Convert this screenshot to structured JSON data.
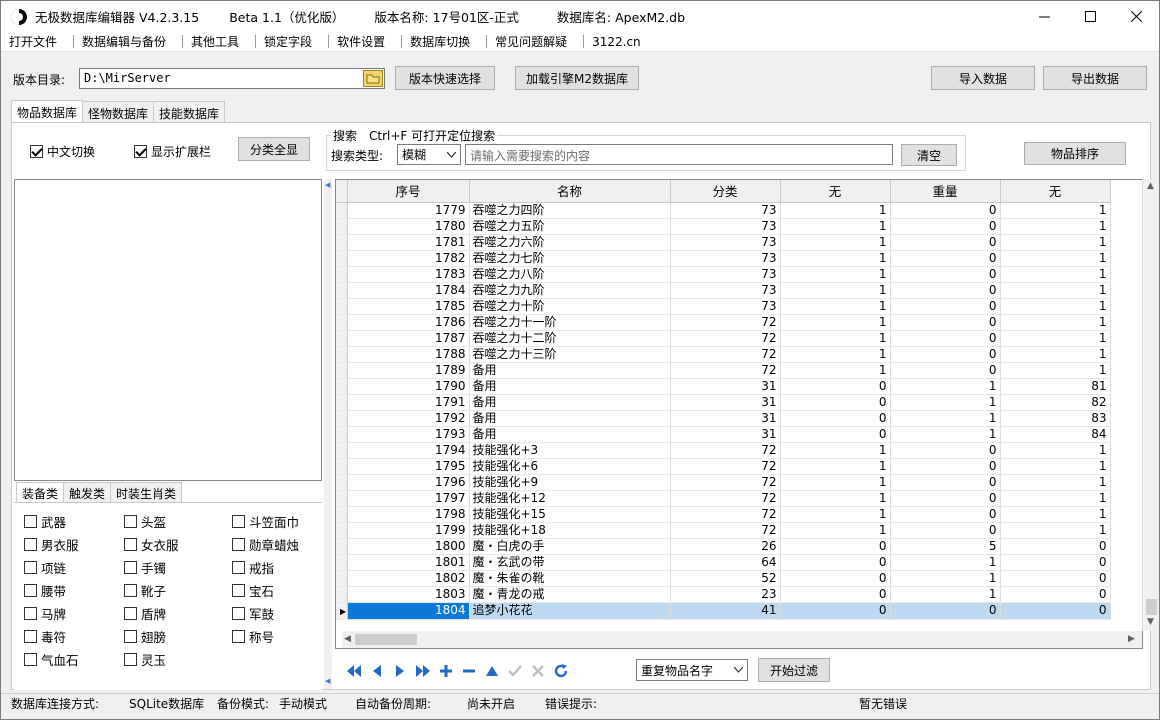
{
  "window": {
    "title_segments": [
      "无极数据库编辑器 V4.2.3.15",
      "Beta 1.1（优化版）",
      "版本名称: 17号01区-正式",
      "数据库名: ApexM2.db"
    ]
  },
  "menu": {
    "items": [
      "打开文件",
      "数据编辑与备份",
      "其他工具",
      "锁定字段",
      "软件设置",
      "数据库切换",
      "常见问题解疑",
      "3122.cn"
    ]
  },
  "toolbar": {
    "dir_label": "版本目录:",
    "dir_value": "D:\\MirServer",
    "quick_select": "版本快速选择",
    "load_engine": "加载引擎M2数据库",
    "import": "导入数据",
    "export": "导出数据"
  },
  "tabs": [
    "物品数据库",
    "怪物数据库",
    "技能数据库"
  ],
  "filter": {
    "chinese_toggle": "中文切换",
    "show_ext": "显示扩展栏",
    "expand_all": "分类全显",
    "search_legend": "搜索　Ctrl+F 可打开定位搜索",
    "search_type_label": "搜索类型:",
    "search_type_value": "模糊",
    "search_placeholder": "请输入需要搜索的内容",
    "clear": "清空",
    "sort": "物品排序"
  },
  "category_tabs": [
    "装备类",
    "触发类",
    "时装生肖类"
  ],
  "categories": [
    "武器",
    "头盔",
    "斗笠面巾",
    "男衣服",
    "女衣服",
    "勋章蜡烛",
    "项链",
    "手镯",
    "戒指",
    "腰带",
    "靴子",
    "宝石",
    "马牌",
    "盾牌",
    "军鼓",
    "毒符",
    "翅膀",
    "称号",
    "气血石",
    "灵玉"
  ],
  "grid": {
    "columns": [
      "序号",
      "名称",
      "分类",
      "无",
      "重量",
      "无"
    ],
    "rows": [
      [
        "1779",
        "吞噬之力四阶",
        "73",
        "1",
        "0",
        "1"
      ],
      [
        "1780",
        "吞噬之力五阶",
        "73",
        "1",
        "0",
        "1"
      ],
      [
        "1781",
        "吞噬之力六阶",
        "73",
        "1",
        "0",
        "1"
      ],
      [
        "1782",
        "吞噬之力七阶",
        "73",
        "1",
        "0",
        "1"
      ],
      [
        "1783",
        "吞噬之力八阶",
        "73",
        "1",
        "0",
        "1"
      ],
      [
        "1784",
        "吞噬之力九阶",
        "73",
        "1",
        "0",
        "1"
      ],
      [
        "1785",
        "吞噬之力十阶",
        "73",
        "1",
        "0",
        "1"
      ],
      [
        "1786",
        "吞噬之力十一阶",
        "72",
        "1",
        "0",
        "1"
      ],
      [
        "1787",
        "吞噬之力十二阶",
        "72",
        "1",
        "0",
        "1"
      ],
      [
        "1788",
        "吞噬之力十三阶",
        "72",
        "1",
        "0",
        "1"
      ],
      [
        "1789",
        "备用",
        "72",
        "1",
        "0",
        "1"
      ],
      [
        "1790",
        "备用",
        "31",
        "0",
        "1",
        "81"
      ],
      [
        "1791",
        "备用",
        "31",
        "0",
        "1",
        "82"
      ],
      [
        "1792",
        "备用",
        "31",
        "0",
        "1",
        "83"
      ],
      [
        "1793",
        "备用",
        "31",
        "0",
        "1",
        "84"
      ],
      [
        "1794",
        "技能强化+3",
        "72",
        "1",
        "0",
        "1"
      ],
      [
        "1795",
        "技能强化+6",
        "72",
        "1",
        "0",
        "1"
      ],
      [
        "1796",
        "技能强化+9",
        "72",
        "1",
        "0",
        "1"
      ],
      [
        "1797",
        "技能强化+12",
        "72",
        "1",
        "0",
        "1"
      ],
      [
        "1798",
        "技能强化+15",
        "72",
        "1",
        "0",
        "1"
      ],
      [
        "1799",
        "技能强化+18",
        "72",
        "1",
        "0",
        "1"
      ],
      [
        "1800",
        "魔・白虎の手",
        "26",
        "0",
        "5",
        "0"
      ],
      [
        "1801",
        "魔・玄武の带",
        "64",
        "0",
        "1",
        "0"
      ],
      [
        "1802",
        "魔・朱雀の靴",
        "52",
        "0",
        "1",
        "0"
      ],
      [
        "1803",
        "魔・青龙の戒",
        "23",
        "0",
        "1",
        "0"
      ],
      [
        "1804",
        "追梦小花花",
        "41",
        "0",
        "0",
        "0"
      ]
    ],
    "selected_row": 25
  },
  "bottom": {
    "filter_select": "重复物品名字",
    "start_filter": "开始过滤"
  },
  "status": {
    "conn_label": "数据库连接方式:",
    "conn_value": "SQLite数据库",
    "backup_label": "备份模式:",
    "backup_value": "手动模式",
    "auto_label": "自动备份周期:",
    "auto_value": "尚未开启",
    "error_label": "错误提示:",
    "error_value": "暂无错误"
  }
}
